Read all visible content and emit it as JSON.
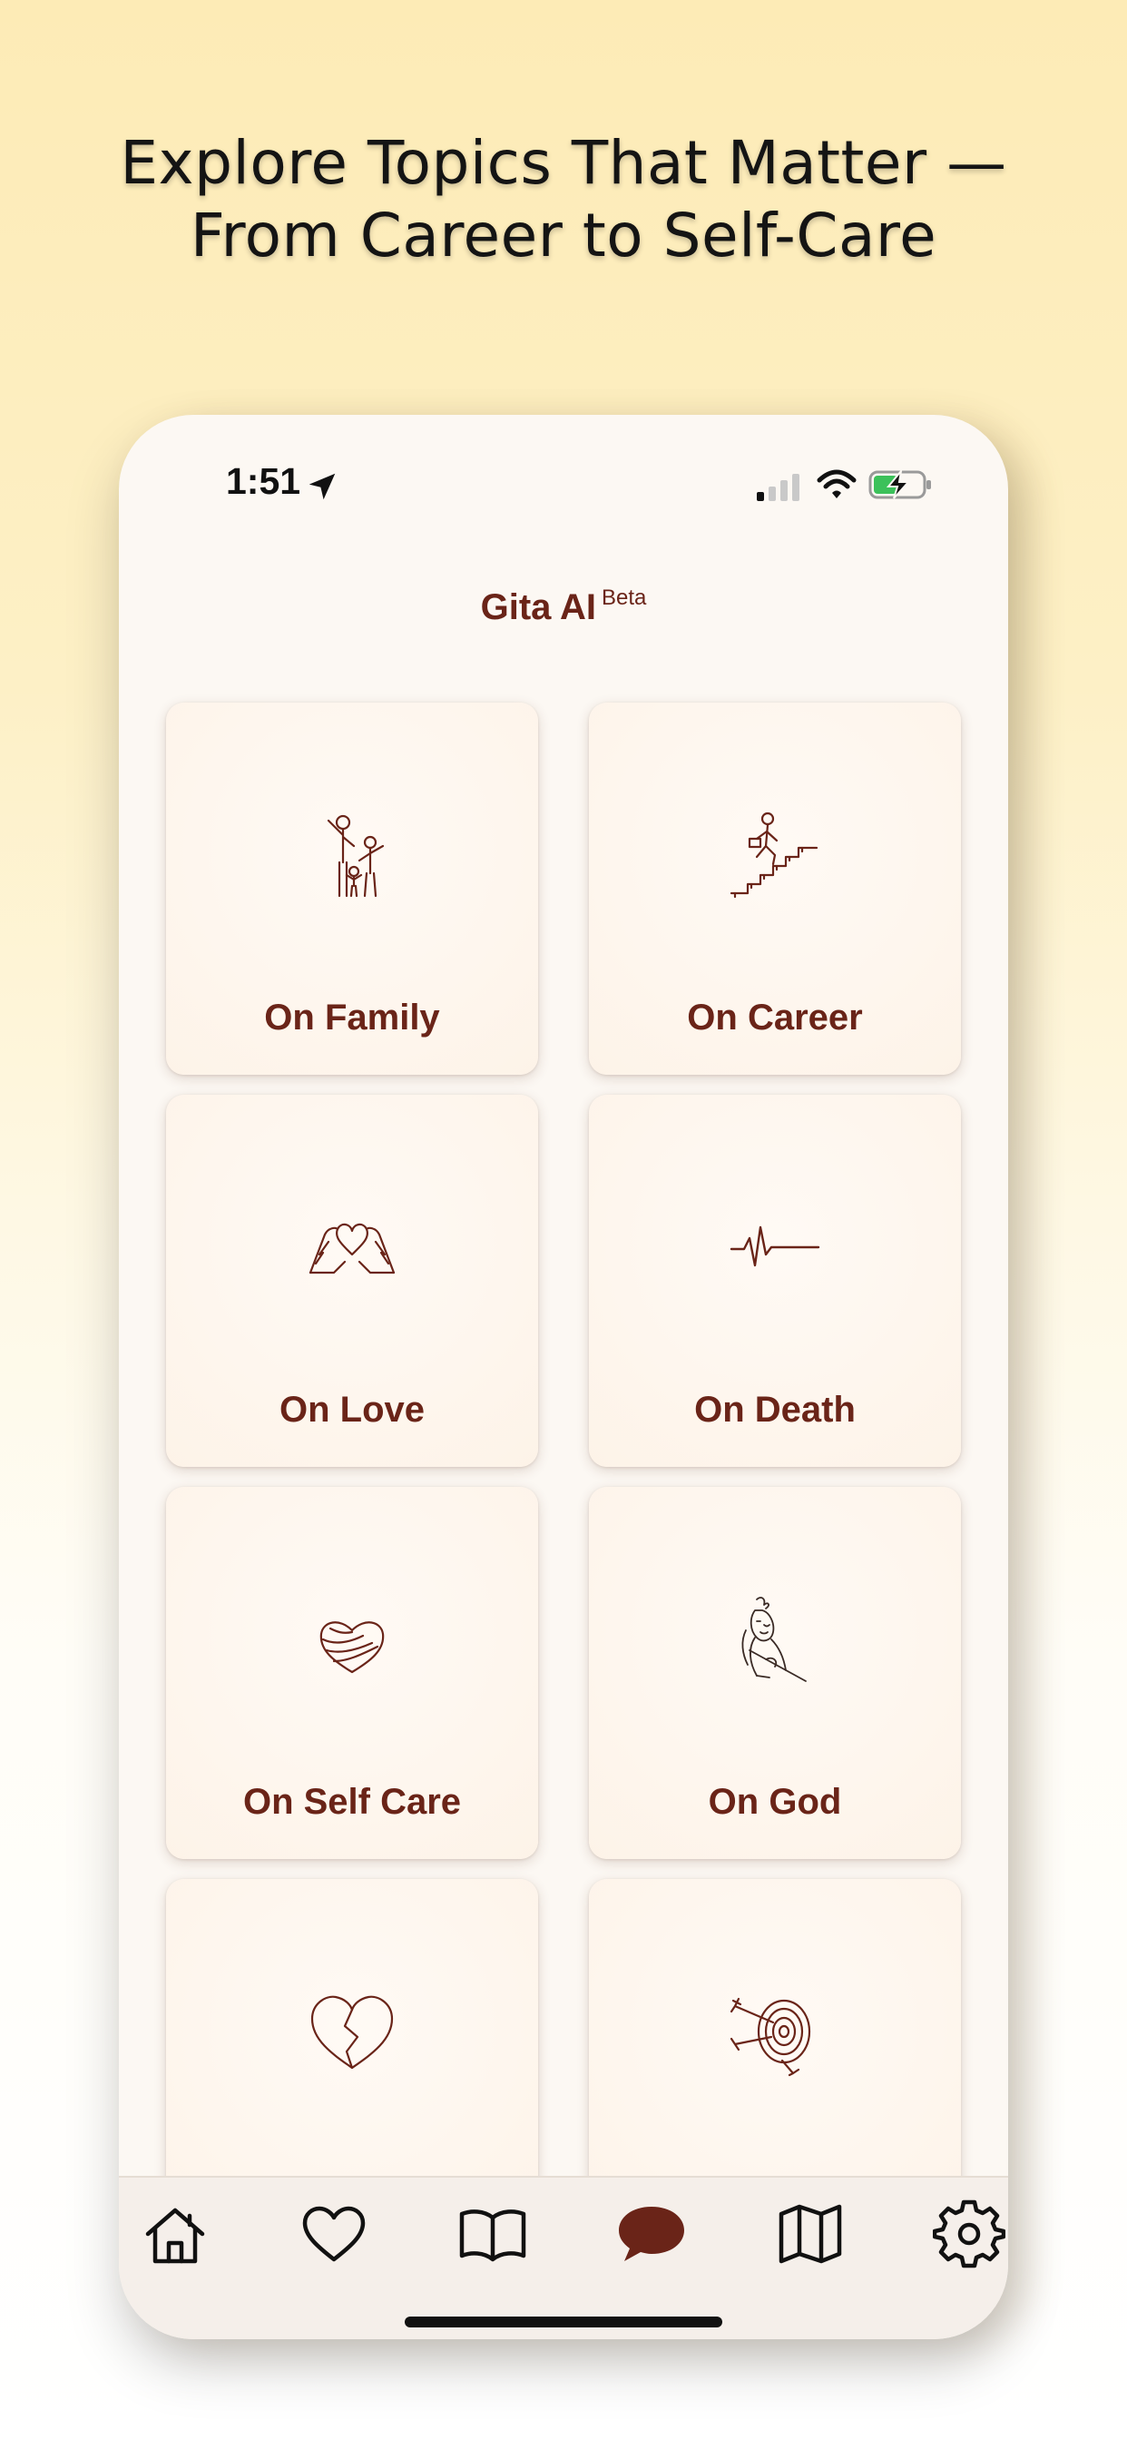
{
  "headline": {
    "line1": "Explore Topics That Matter —",
    "line2": "From Career to Self-Care"
  },
  "status_bar": {
    "time": "1:51",
    "location_icon": "location-arrow-icon",
    "signal_icon": "cellular-signal-icon",
    "wifi_icon": "wifi-icon",
    "battery_icon": "battery-charging-icon"
  },
  "app": {
    "title": "Gita AI",
    "badge": "Beta"
  },
  "topics": [
    {
      "label": "On Family",
      "icon": "family-icon"
    },
    {
      "label": "On Career",
      "icon": "career-stairs-icon"
    },
    {
      "label": "On Love",
      "icon": "heart-hands-icon"
    },
    {
      "label": "On Death",
      "icon": "heartbeat-line-icon"
    },
    {
      "label": "On Self Care",
      "icon": "self-hug-heart-icon"
    },
    {
      "label": "On God",
      "icon": "krishna-icon"
    },
    {
      "label": "",
      "icon": "broken-heart-icon"
    },
    {
      "label": "",
      "icon": "target-arrows-icon"
    }
  ],
  "tab_bar": [
    {
      "name": "home",
      "icon": "home-icon",
      "active": false
    },
    {
      "name": "favorites",
      "icon": "heart-icon",
      "active": false
    },
    {
      "name": "read",
      "icon": "book-icon",
      "active": false
    },
    {
      "name": "chat",
      "icon": "chat-bubble-icon",
      "active": true
    },
    {
      "name": "map",
      "icon": "map-icon",
      "active": false
    },
    {
      "name": "settings",
      "icon": "gear-icon",
      "active": false
    }
  ],
  "colors": {
    "accent": "#6a2418",
    "background_top": "#fdebb6",
    "card": "#fdf3e8"
  }
}
